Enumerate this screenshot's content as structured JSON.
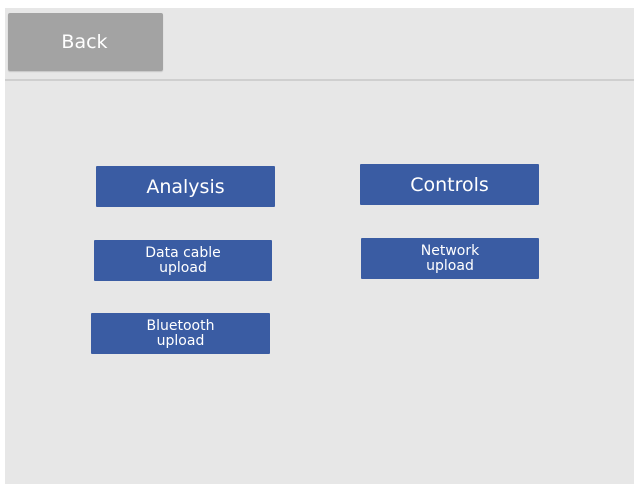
{
  "header": {
    "back_label": "Back"
  },
  "menu": {
    "analysis_label": "Analysis",
    "controls_label": "Controls",
    "data_cable_upload": {
      "line1": "Data cable",
      "line2": "upload"
    },
    "network_upload": {
      "line1": "Network",
      "line2": "upload"
    },
    "bluetooth_upload": {
      "line1": "Bluetooth",
      "line2": "upload"
    }
  },
  "colors": {
    "background": "#e7e7e7",
    "back_button": "#a3a3a3",
    "primary_button": "#3a5ca3",
    "button_text": "#ffffff"
  }
}
